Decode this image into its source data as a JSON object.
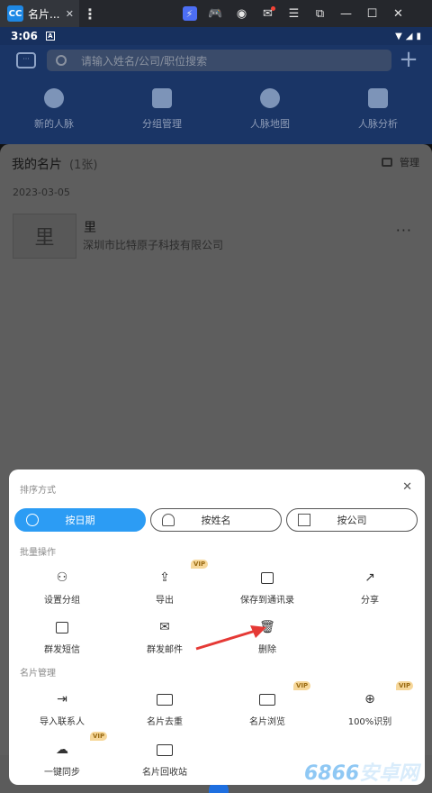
{
  "emulator": {
    "app_badge": "CC",
    "tab_title": "名片...",
    "icons": [
      "bolt-icon",
      "gamepad-icon",
      "account-icon",
      "mail-icon",
      "menu-icon",
      "popout-icon",
      "minimize-icon",
      "maximize-icon",
      "close-icon"
    ]
  },
  "status_bar": {
    "time": "3:06",
    "notification_glyph": "A"
  },
  "header": {
    "search_placeholder": "请输入姓名/公司/职位搜索",
    "quick_actions": [
      {
        "label": "新的人脉",
        "icon": "new-contacts-icon"
      },
      {
        "label": "分组管理",
        "icon": "group-folder-icon"
      },
      {
        "label": "人脉地图",
        "icon": "map-pin-icon"
      },
      {
        "label": "人脉分析",
        "icon": "analysis-chart-icon"
      }
    ]
  },
  "content": {
    "title": "我的名片",
    "count": "(1张)",
    "manage": "管理",
    "date": "2023-03-05",
    "card": {
      "thumb_text": "里",
      "name": "里",
      "company": "深圳市比特原子科技有限公司"
    }
  },
  "sheet": {
    "sort_title": "排序方式",
    "sort_options": [
      {
        "label": "按日期",
        "active": true
      },
      {
        "label": "按姓名",
        "active": false
      },
      {
        "label": "按公司",
        "active": false
      }
    ],
    "batch_title": "批量操作",
    "batch_actions": [
      {
        "label": "设置分组",
        "icon": "group-settings-icon",
        "vip": false
      },
      {
        "label": "导出",
        "icon": "export-icon",
        "vip": true
      },
      {
        "label": "保存到通讯录",
        "icon": "address-book-icon",
        "vip": false
      },
      {
        "label": "分享",
        "icon": "share-icon",
        "vip": false
      },
      {
        "label": "群发短信",
        "icon": "sms-icon",
        "vip": false
      },
      {
        "label": "群发邮件",
        "icon": "email-icon",
        "vip": false
      },
      {
        "label": "删除",
        "icon": "trash-icon",
        "vip": false
      }
    ],
    "manage_title": "名片管理",
    "manage_actions": [
      {
        "label": "导入联系人",
        "icon": "import-contact-icon",
        "vip": false
      },
      {
        "label": "名片去重",
        "icon": "dedupe-card-icon",
        "vip": false
      },
      {
        "label": "名片浏览",
        "icon": "card-browse-icon",
        "vip": true
      },
      {
        "label": "100%识别",
        "icon": "target-icon",
        "vip": true
      },
      {
        "label": "一键同步",
        "icon": "cloud-sync-icon",
        "vip": true
      },
      {
        "label": "名片回收站",
        "icon": "recycle-card-icon",
        "vip": false
      }
    ],
    "vip_badge": "VIP"
  },
  "watermark": {
    "prefix": "6866",
    "suffix": "安卓网"
  }
}
